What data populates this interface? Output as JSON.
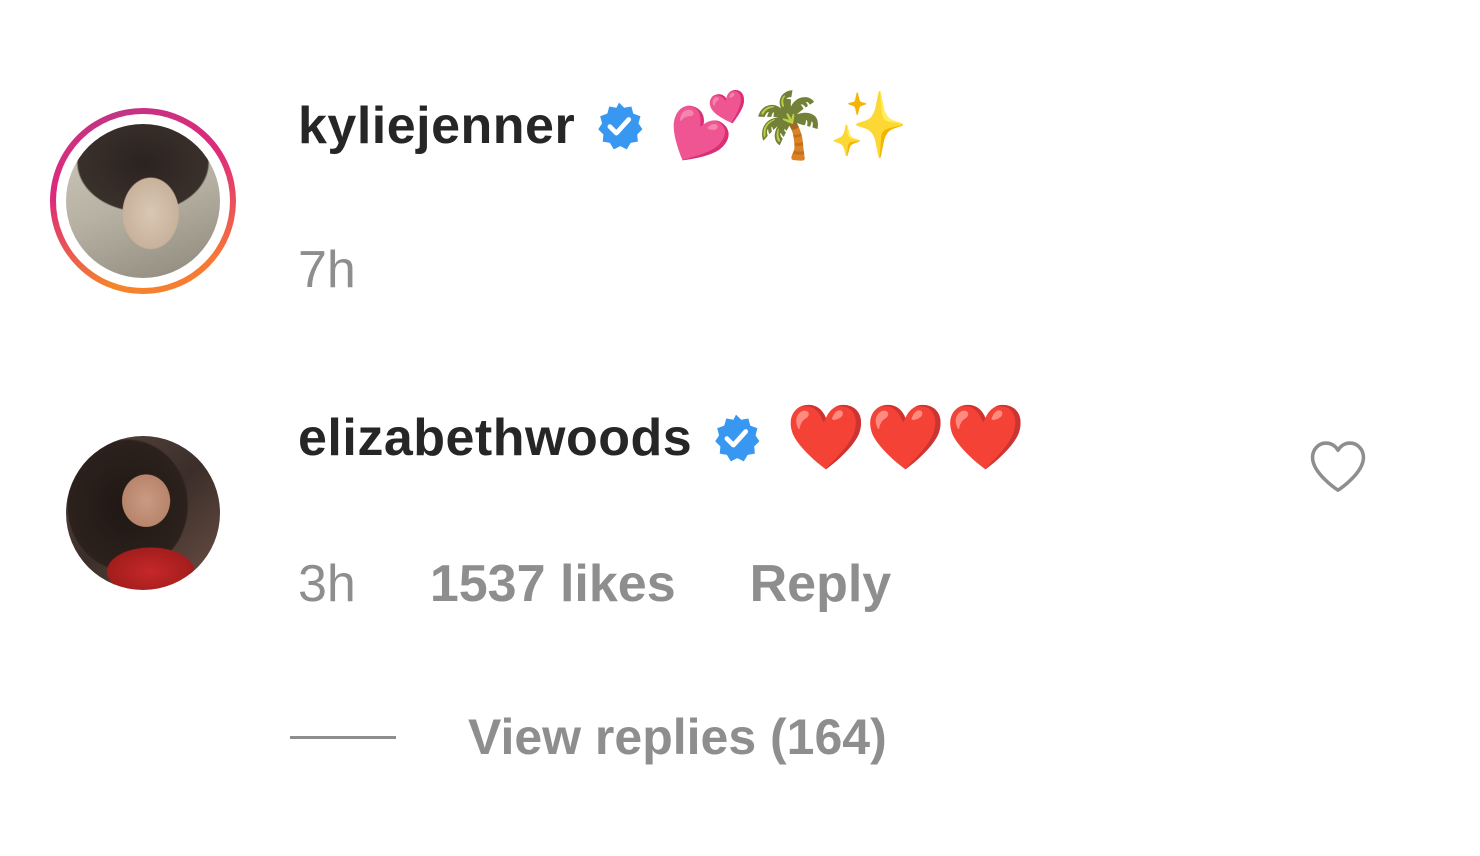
{
  "comments": [
    {
      "username": "kyliejenner",
      "verified": true,
      "text": "💕🌴✨",
      "time": "7h",
      "has_story_ring": true
    },
    {
      "username": "elizabethwoods",
      "verified": true,
      "text": "❤️❤️❤️",
      "time": "3h",
      "likes": "1537 likes",
      "reply_label": "Reply",
      "view_replies": "View replies (164)"
    }
  ],
  "icons": {
    "verified": "verified-badge-icon",
    "like": "heart-outline-icon"
  },
  "colors": {
    "verified_blue": "#3897f0",
    "secondary_text": "#8e8e8e",
    "primary_text": "#262626"
  }
}
